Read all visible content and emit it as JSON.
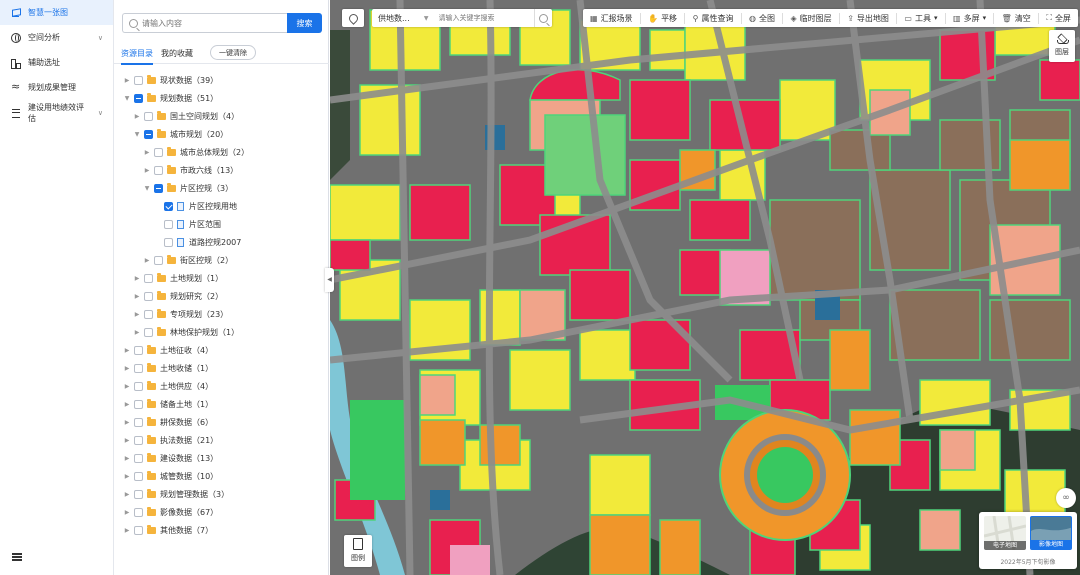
{
  "nav": {
    "items": [
      {
        "label": "智慧一张图",
        "icon": "layers-icon",
        "active": true
      },
      {
        "label": "空间分析",
        "icon": "globe-icon",
        "expandable": true
      },
      {
        "label": "辅助选址",
        "icon": "split-icon"
      },
      {
        "label": "规划成果管理",
        "icon": "wave-icon"
      },
      {
        "label": "建设用地绩效评估",
        "icon": "list-icon",
        "expandable": true
      }
    ]
  },
  "panel": {
    "search_placeholder": "请输入内容",
    "search_button": "搜索",
    "tabs": [
      "资源目录",
      "我的收藏"
    ],
    "clear_button": "一键清除",
    "tree": [
      {
        "level": 0,
        "toggle": "collapsed",
        "check": "none",
        "type": "folder",
        "label": "现状数据（39）"
      },
      {
        "level": 0,
        "toggle": "expanded",
        "check": "half",
        "type": "folder",
        "label": "规划数据（51）"
      },
      {
        "level": 1,
        "toggle": "collapsed",
        "check": "none",
        "type": "folder",
        "label": "国土空间规划（4）"
      },
      {
        "level": 1,
        "toggle": "expanded",
        "check": "half",
        "type": "folder",
        "label": "城市规划（20）"
      },
      {
        "level": 2,
        "toggle": "collapsed",
        "check": "none",
        "type": "folder",
        "label": "城市总体规划（2）"
      },
      {
        "level": 2,
        "toggle": "collapsed",
        "check": "none",
        "type": "folder",
        "label": "市政六线（13）"
      },
      {
        "level": 2,
        "toggle": "expanded",
        "check": "half",
        "type": "folder",
        "label": "片区控规（3）"
      },
      {
        "level": 3,
        "toggle": "none",
        "check": "checked",
        "type": "file",
        "label": "片区控规用地"
      },
      {
        "level": 3,
        "toggle": "none",
        "check": "none",
        "type": "file",
        "label": "片区范围"
      },
      {
        "level": 3,
        "toggle": "none",
        "check": "none",
        "type": "file",
        "label": "道路控规2007"
      },
      {
        "level": 2,
        "toggle": "collapsed",
        "check": "none",
        "type": "folder",
        "label": "街区控规（2）"
      },
      {
        "level": 1,
        "toggle": "collapsed",
        "check": "none",
        "type": "folder",
        "label": "土地规划（1）"
      },
      {
        "level": 1,
        "toggle": "collapsed",
        "check": "none",
        "type": "folder",
        "label": "规划研究（2）"
      },
      {
        "level": 1,
        "toggle": "collapsed",
        "check": "none",
        "type": "folder",
        "label": "专项规划（23）"
      },
      {
        "level": 1,
        "toggle": "collapsed",
        "check": "none",
        "type": "folder",
        "label": "林地保护规划（1）"
      },
      {
        "level": 0,
        "toggle": "collapsed",
        "check": "none",
        "type": "folder",
        "label": "土地征收（4）"
      },
      {
        "level": 0,
        "toggle": "collapsed",
        "check": "none",
        "type": "folder",
        "label": "土地收储（1）"
      },
      {
        "level": 0,
        "toggle": "collapsed",
        "check": "none",
        "type": "folder",
        "label": "土地供应（4）"
      },
      {
        "level": 0,
        "toggle": "collapsed",
        "check": "none",
        "type": "folder",
        "label": "储备土地（1）"
      },
      {
        "level": 0,
        "toggle": "collapsed",
        "check": "none",
        "type": "folder",
        "label": "耕保数据（6）"
      },
      {
        "level": 0,
        "toggle": "collapsed",
        "check": "none",
        "type": "folder",
        "label": "执法数据（21）"
      },
      {
        "level": 0,
        "toggle": "collapsed",
        "check": "none",
        "type": "folder",
        "label": "建设数据（13）"
      },
      {
        "level": 0,
        "toggle": "collapsed",
        "check": "none",
        "type": "folder",
        "label": "城管数据（10）"
      },
      {
        "level": 0,
        "toggle": "collapsed",
        "check": "none",
        "type": "folder",
        "label": "规划管理数据（3）"
      },
      {
        "level": 0,
        "toggle": "collapsed",
        "check": "none",
        "type": "folder",
        "label": "影像数据（67）"
      },
      {
        "level": 0,
        "toggle": "collapsed",
        "check": "none",
        "type": "folder",
        "label": "其他数据（7）"
      }
    ]
  },
  "map": {
    "search_select": "供地数...",
    "search_placeholder": "请输入关键字搜索",
    "tools": [
      {
        "label": "汇报场景",
        "icon": "report-icon"
      },
      {
        "label": "平移",
        "icon": "hand-icon"
      },
      {
        "label": "属性查询",
        "icon": "info-pin-icon"
      },
      {
        "label": "全图",
        "icon": "globe-icon"
      },
      {
        "label": "临时图层",
        "icon": "stack-icon"
      },
      {
        "label": "导出地图",
        "icon": "export-icon"
      },
      {
        "label": "工具",
        "icon": "toolbox-icon",
        "dropdown": true
      },
      {
        "label": "多屏",
        "icon": "grid-icon",
        "dropdown": true
      },
      {
        "label": "清空",
        "icon": "trash-icon"
      },
      {
        "label": "全屏",
        "icon": "fullscreen-icon"
      }
    ],
    "layers_label": "图层",
    "legend_label": "图例",
    "basemap": {
      "vector_label": "电子地图",
      "imagery_label": "影像地图",
      "date": "2022年5月下旬影像"
    }
  },
  "colors": {
    "accent": "#1a73e8",
    "residential": "#f2ea3a",
    "commercial": "#e8204f",
    "industrial": "#8a6f5a",
    "education": "#f0a0a0",
    "green": "#3cc870",
    "public": "#f0962a",
    "pink": "#f5b7c8"
  }
}
